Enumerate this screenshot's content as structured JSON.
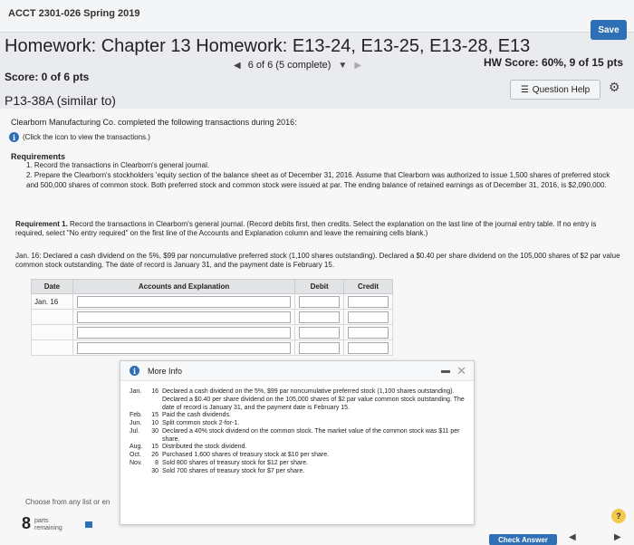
{
  "header": {
    "course": "ACCT 2301-026 Spring 2019",
    "save_label": "Save",
    "title": "Homework: Chapter 13 Homework: E13-24, E13-25, E13-28, E13"
  },
  "status": {
    "score": "Score: 0 of 6 pts",
    "pager": "6 of 6 (5 complete)",
    "hw_score": "HW Score: 60%, 9 of 15 pts"
  },
  "problem": {
    "id": "P13-38A (similar to)",
    "help_label": "Question Help"
  },
  "content": {
    "intro": "Clearborn Manufacturing Co. completed the following transactions during 2016:",
    "click_hint": "(Click the icon to view the transactions.)",
    "requirements_title": "Requirements",
    "requirements": [
      "1.  Record the transactions in Clearborn's general journal.",
      "2.  Prepare the Clearborn's stockholders 'equity section of the balance sheet as of December 31, 2016. Assume that Clearborn was authorized to issue 1,500 shares of preferred stock and 500,000 shares of common stock. Both preferred stock and common stock were issued at par. The ending balance of retained earnings as of December 31, 2016, is $2,090,000."
    ],
    "req1_bold": "Requirement 1.",
    "req1_text": " Record the transactions in Clearborn's general journal. (Record debits first, then credits. Select the explanation on the last line of the journal entry table. If no entry is required, select \"No entry required\" on the first line of the Accounts and Explanation column and leave the remaining cells blank.)",
    "transaction": "Jan. 16: Declared a cash dividend on the 5%, $99 par noncumulative preferred stock (1,100 shares outstanding). Declared a $0.40 per share dividend on the 105,000 shares of $2 par value common stock outstanding. The date of record is January 31, and the payment date is February 15."
  },
  "journal": {
    "headers": [
      "Date",
      "Accounts and Explanation",
      "Debit",
      "Credit"
    ],
    "date": "Jan. 16"
  },
  "modal": {
    "title": "More Info",
    "entries": [
      {
        "m": "Jan.",
        "d": "16",
        "t": "Declared a cash dividend on the 5%, $99 par noncumulative preferred stock (1,100 shares outstanding). Declared a $0.40 per share dividend on the 105,000 shares of $2 par value common stock outstanding. The date of record is January 31, and the payment date is February 15."
      },
      {
        "m": "Feb.",
        "d": "15",
        "t": "Paid the cash dividends."
      },
      {
        "m": "Jun.",
        "d": "10",
        "t": "Split common stock 2-for-1."
      },
      {
        "m": "Jul.",
        "d": "30",
        "t": "Declared a 40% stock dividend on the common stock. The market value of the common stock was $11 per share."
      },
      {
        "m": "Aug.",
        "d": "15",
        "t": "Distributed the stock dividend."
      },
      {
        "m": "Oct.",
        "d": "26",
        "t": "Purchased 1,600 shares of treasury stock at $10 per share."
      },
      {
        "m": "Nov.",
        "d": "8",
        "t": "Sold 800 shares of treasury stock for $12 per share."
      },
      {
        "m": "",
        "d": "30",
        "t": "Sold 700 shares of treasury stock for $7 per share."
      }
    ]
  },
  "footer": {
    "choose": "Choose from any list or en",
    "parts_num": "8",
    "parts_label_1": "parts",
    "parts_label_2": "remaining",
    "check_label": "Check Answer"
  }
}
